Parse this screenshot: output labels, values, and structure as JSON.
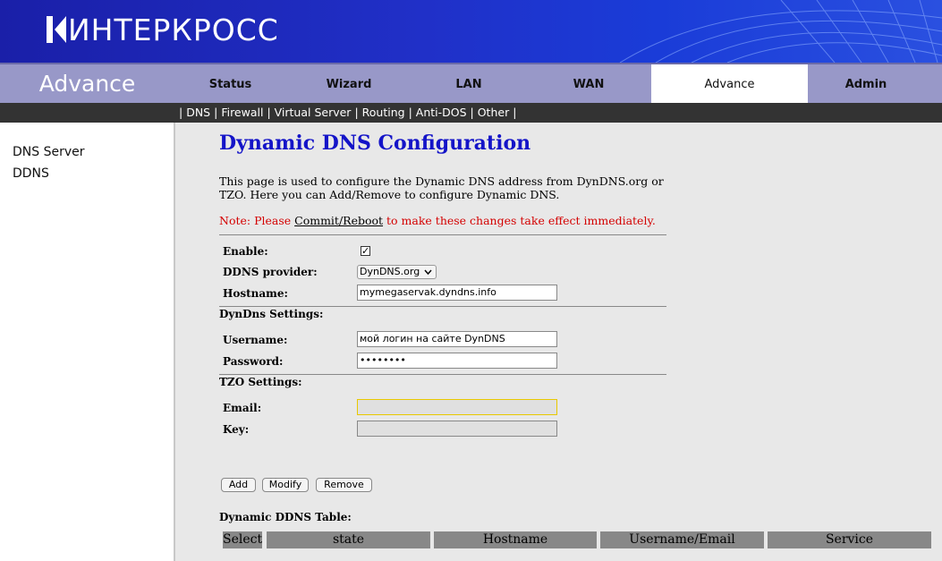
{
  "brand": {
    "logo_text": "ИНТЕРКРОСС"
  },
  "nav": {
    "section_title": "Advance",
    "tabs": [
      {
        "label": "Status"
      },
      {
        "label": "Wizard"
      },
      {
        "label": "LAN"
      },
      {
        "label": "WAN"
      },
      {
        "label": "Advance",
        "active": true
      },
      {
        "label": "Admin"
      }
    ]
  },
  "subnav": {
    "sep": "|",
    "links": [
      "DNS",
      "Firewall",
      "Virtual Server",
      "Routing",
      "Anti-DOS",
      "Other"
    ]
  },
  "sidebar": {
    "items": [
      {
        "label": "DNS Server"
      },
      {
        "label": "DDNS"
      }
    ]
  },
  "page": {
    "title": "Dynamic DNS Configuration",
    "description": "This page is used to configure the Dynamic DNS address from DynDNS.org or TZO. Here you can Add/Remove to configure Dynamic DNS.",
    "note_prefix": "Note: Please ",
    "note_link": "Commit/Reboot",
    "note_suffix": " to make these changes take effect immediately."
  },
  "form": {
    "enable_label": "Enable:",
    "enable_checked": true,
    "provider_label": "DDNS provider:",
    "provider_value": "DynDNS.org",
    "hostname_label": "Hostname:",
    "hostname_value": "mymegaservak.dyndns.info",
    "dyndns_section": "DynDns Settings:",
    "username_label": "Username:",
    "username_value": "мой логин на сайте DynDNS",
    "password_label": "Password:",
    "password_value": "••••••••",
    "tzo_section": "TZO Settings:",
    "email_label": "Email:",
    "email_value": "",
    "key_label": "Key:",
    "key_value": ""
  },
  "buttons": {
    "add": "Add",
    "modify": "Modify",
    "remove": "Remove"
  },
  "table": {
    "title": "Dynamic DDNS Table:",
    "headers": [
      "Select",
      "state",
      "Hostname",
      "Username/Email",
      "Service"
    ]
  },
  "colors": {
    "title": "#1414c8",
    "note": "#d40000",
    "banner": "#1a1fa8",
    "navbar": "#9898c8"
  }
}
